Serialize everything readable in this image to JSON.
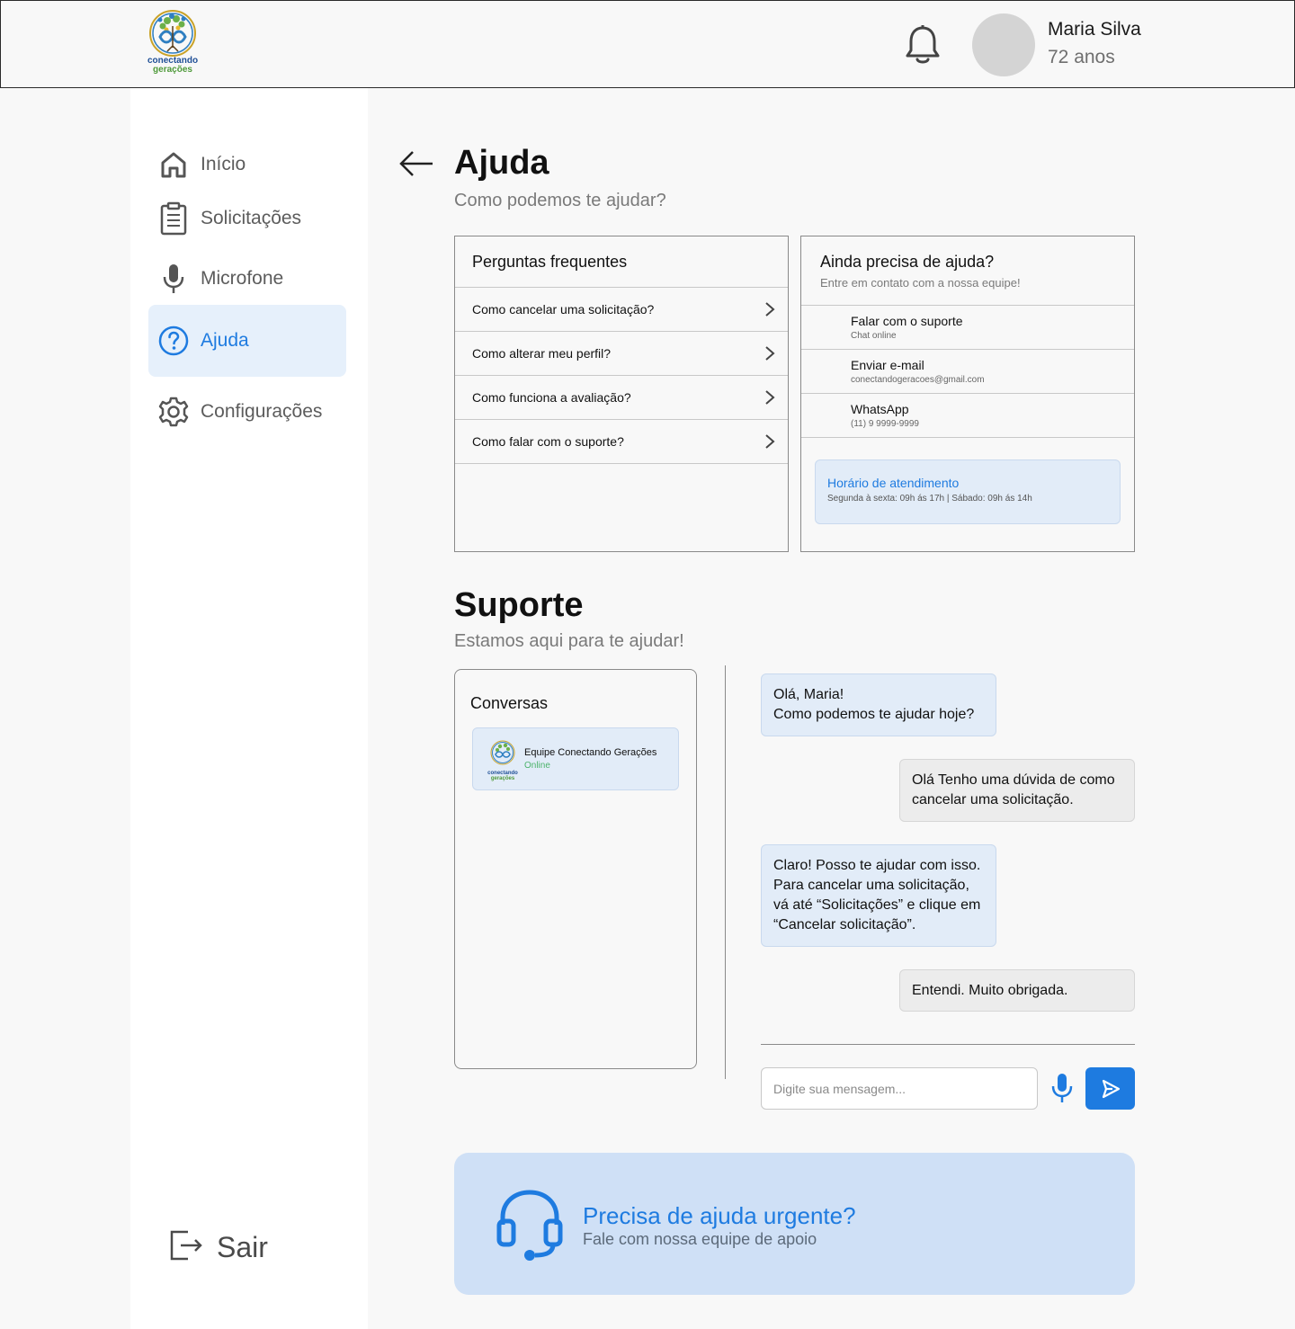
{
  "header": {
    "logo_line1": "conectando",
    "logo_line2": "gerações",
    "user_name": "Maria Silva",
    "user_age": "72 anos"
  },
  "sidebar": {
    "items": [
      {
        "label": "Início",
        "icon": "home-icon"
      },
      {
        "label": "Solicitações",
        "icon": "clipboard-icon"
      },
      {
        "label": "Microfone",
        "icon": "microphone-icon"
      },
      {
        "label": "Ajuda",
        "icon": "help-circle-icon",
        "active": true
      },
      {
        "label": "Configurações",
        "icon": "gear-icon"
      }
    ],
    "logout_label": "Sair"
  },
  "help": {
    "title": "Ajuda",
    "subtitle": "Como podemos te ajudar?"
  },
  "faq": {
    "title": "Perguntas frequentes",
    "items": [
      "Como cancelar uma solicitação?",
      "Como alterar meu perfil?",
      "Como funciona a avaliação?",
      "Como falar com o suporte?"
    ]
  },
  "contact": {
    "title": "Ainda precisa de ajuda?",
    "subtitle": "Entre em contato com a nossa equipe!",
    "items": [
      {
        "title": "Falar com o suporte",
        "detail": "Chat online"
      },
      {
        "title": "Enviar e-mail",
        "detail": "conectandogeracoes@gmail.com"
      },
      {
        "title": "WhatsApp",
        "detail": "(11) 9 9999-9999"
      }
    ],
    "hours_title": "Horário de atendimento",
    "hours_detail": "Segunda à sexta: 09h ás 17h | Sábado: 09h ás 14h"
  },
  "support": {
    "title": "Suporte",
    "subtitle": "Estamos aqui para te ajudar!",
    "conversations_title": "Conversas",
    "conversation": {
      "name": "Equipe Conectando Gerações",
      "status": "Online",
      "logo_line1": "conectando",
      "logo_line2": "gerações"
    },
    "messages": [
      {
        "from": "team",
        "text": "Olá, Maria!\nComo podemos te ajudar hoje?"
      },
      {
        "from": "user",
        "text": "Olá Tenho uma dúvida de como cancelar uma solicitação."
      },
      {
        "from": "team",
        "text": "Claro! Posso te ajudar com isso. Para cancelar uma solicitação, vá até “Solicitações” e clique em “Cancelar solicitação”."
      },
      {
        "from": "user",
        "text": "Entendi. Muito obrigada."
      }
    ],
    "input_placeholder": "Digite sua mensagem..."
  },
  "urgent": {
    "title": "Precisa de ajuda urgente?",
    "subtitle": "Fale com nossa equipe de apoio"
  },
  "colors": {
    "accent": "#1e7be0",
    "active_bg": "#e6f0fb",
    "bubble_in": "#e2ecf8",
    "bubble_out": "#ececec",
    "urgent_bg": "#cfe0f6",
    "online": "#4cb36b"
  }
}
